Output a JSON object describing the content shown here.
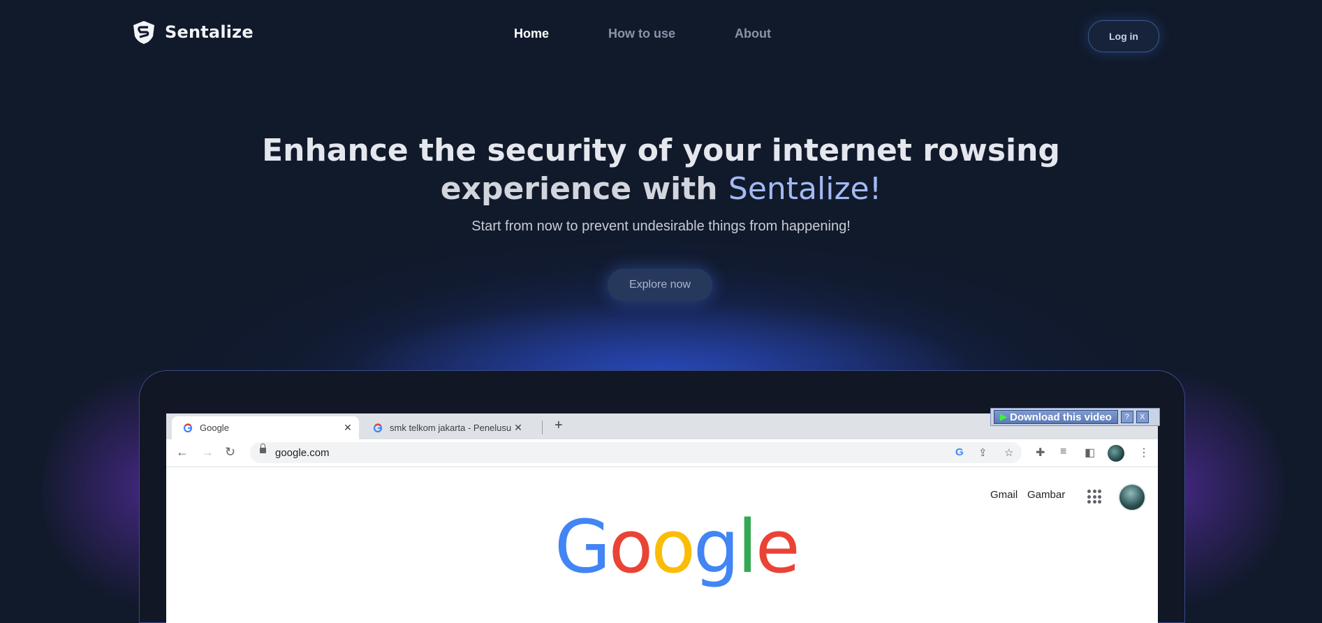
{
  "brand": {
    "name": "Sentalize"
  },
  "nav": {
    "home": "Home",
    "how_to_use": "How to use",
    "about": "About",
    "login": "Log in"
  },
  "hero": {
    "title_line1": "Enhance the security of your internet rowsing",
    "title_line2_prefix": "experience with ",
    "title_accent": "Sentalize!",
    "subtitle": "Start from now to prevent undesirable things from happening!",
    "cta": "Explore now"
  },
  "browser": {
    "tabs": [
      {
        "title": "Google"
      },
      {
        "title": "smk telkom jakarta - Penelusuran"
      }
    ],
    "url": "google.com",
    "gmail": "Gmail",
    "images": "Gambar",
    "logo": {
      "G": "G",
      "o1": "o",
      "o2": "o",
      "g": "g",
      "l": "l",
      "e": "e"
    }
  },
  "download_bar": {
    "label": "Download this video",
    "help": "?",
    "close": "X"
  },
  "colors": {
    "background": "#111a2b",
    "accent": "#a4b9f4",
    "glow": "#3a5ae0"
  }
}
